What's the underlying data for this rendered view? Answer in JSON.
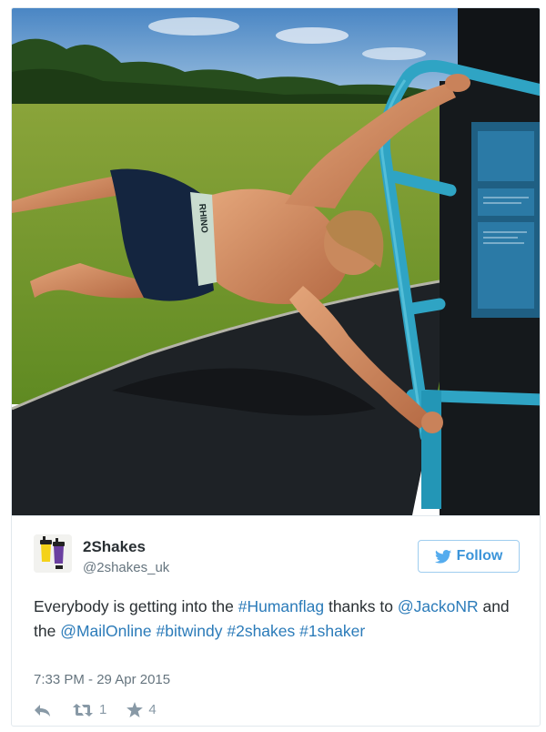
{
  "user": {
    "display_name": "2Shakes",
    "handle": "@2shakes_uk"
  },
  "follow_button": {
    "label": "Follow",
    "icon": "twitter-bird-icon"
  },
  "tweet": {
    "text_parts": [
      {
        "text": "Everybody is getting into the ",
        "link": false
      },
      {
        "text": "#Humanflag",
        "link": true
      },
      {
        "text": " thanks to ",
        "link": false
      },
      {
        "text": "@JackoNR",
        "link": true
      },
      {
        "text": " and the ",
        "link": false
      },
      {
        "text": "@MailOnline",
        "link": true
      },
      {
        "text": " ",
        "link": false
      },
      {
        "text": "#bitwindy",
        "link": true
      },
      {
        "text": " ",
        "link": false
      },
      {
        "text": "#2shakes",
        "link": true
      },
      {
        "text": " ",
        "link": false
      },
      {
        "text": "#1shaker",
        "link": true
      }
    ],
    "timestamp": "7:33 PM - 29 Apr 2015"
  },
  "actions": {
    "reply_icon": "reply-icon",
    "retweet_icon": "retweet-icon",
    "retweet_count": "1",
    "favorite_icon": "star-icon",
    "favorite_count": "4"
  },
  "colors": {
    "link": "#2b7bb9",
    "follow_border": "#9fcdef",
    "follow_text": "#3b94d9",
    "meta_text": "#66757f"
  }
}
